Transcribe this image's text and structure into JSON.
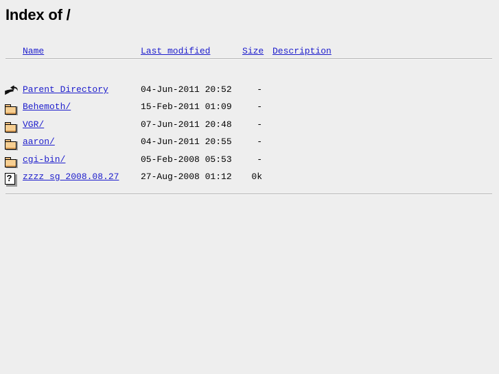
{
  "page": {
    "title": "Index of /",
    "background_color": "#eeeeee",
    "link_color": "#1c1ccc",
    "text_color": "#000000"
  },
  "columns": {
    "name": "Name",
    "last_modified": "Last modified",
    "size": "Size",
    "description": "Description"
  },
  "rows": [
    {
      "icon": "back-icon",
      "name": "Parent Directory",
      "last_modified": "04-Jun-2011 20:52",
      "size": "-",
      "description": ""
    },
    {
      "icon": "folder-icon",
      "name": "Behemoth/",
      "last_modified": "15-Feb-2011 01:09",
      "size": "-",
      "description": ""
    },
    {
      "icon": "folder-icon",
      "name": "VGR/",
      "last_modified": "07-Jun-2011 20:48",
      "size": "-",
      "description": ""
    },
    {
      "icon": "folder-icon",
      "name": "aaron/",
      "last_modified": "04-Jun-2011 20:55",
      "size": "-",
      "description": ""
    },
    {
      "icon": "folder-icon",
      "name": "cgi-bin/",
      "last_modified": "05-Feb-2008 05:53",
      "size": "-",
      "description": ""
    },
    {
      "icon": "unknown-file-icon",
      "name": "zzzz_sg_2008.08.27",
      "last_modified": "27-Aug-2008 01:12",
      "size": "0k",
      "description": ""
    }
  ],
  "icons": {
    "unknown_glyph": "?"
  }
}
